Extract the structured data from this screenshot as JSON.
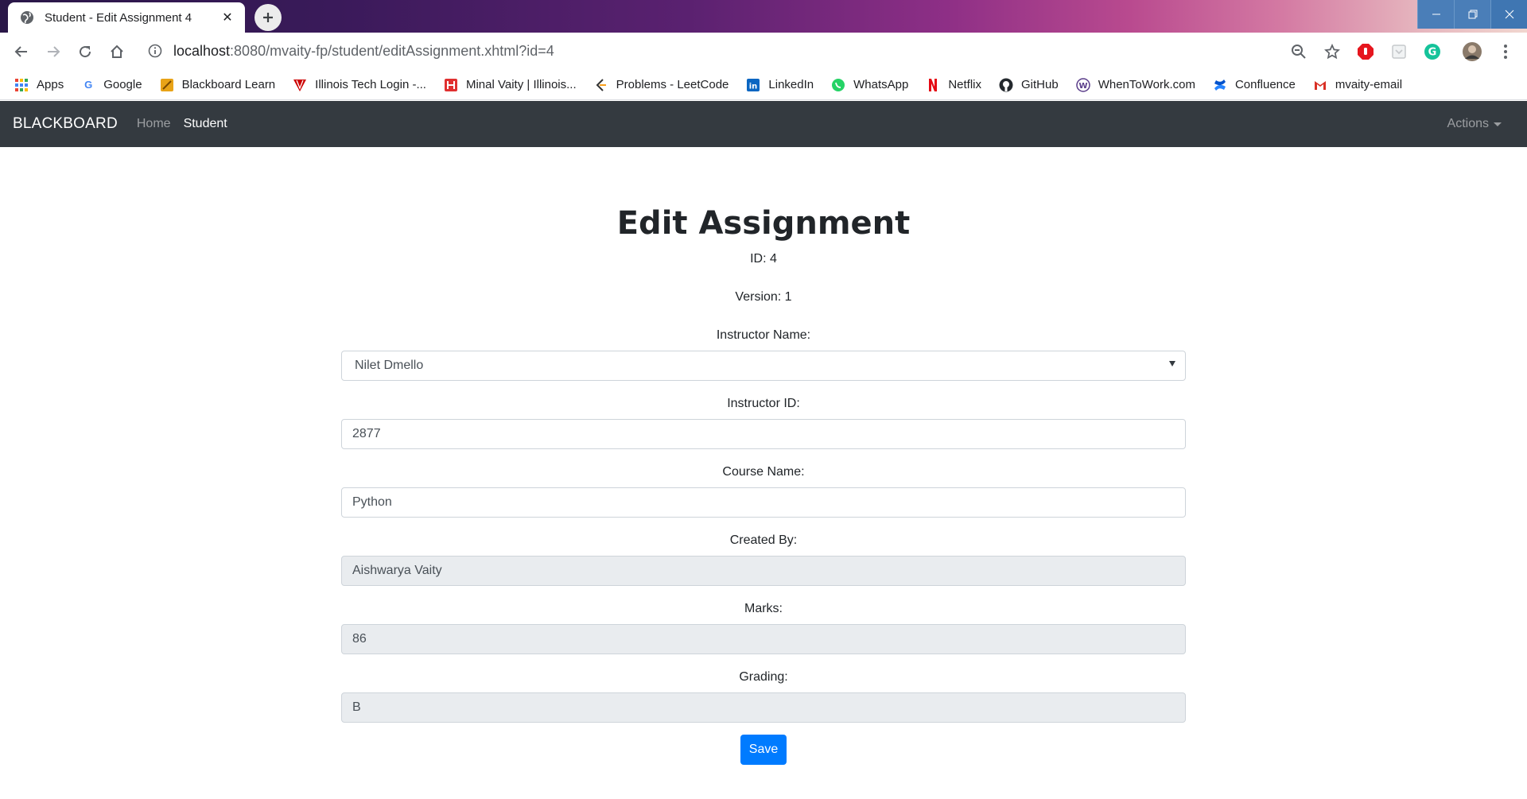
{
  "browser": {
    "tab_title": "Student - Edit Assignment 4",
    "url_host": "localhost",
    "url_rest": ":8080/mvaity-fp/student/editAssignment.xhtml?id=4",
    "bookmarks": [
      {
        "label": "Apps",
        "icon": "apps-grid-icon",
        "color": "#ea4335"
      },
      {
        "label": "Google",
        "icon": "google-icon",
        "color": "#4285f4"
      },
      {
        "label": "Blackboard Learn",
        "icon": "blackboard-icon",
        "color": "#e8a317"
      },
      {
        "label": "Illinois Tech Login -...",
        "icon": "illinois-tech-icon",
        "color": "#cc0000"
      },
      {
        "label": "Minal Vaity | Illinois...",
        "icon": "handshake-icon",
        "color": "#e03030"
      },
      {
        "label": "Problems - LeetCode",
        "icon": "leetcode-icon",
        "color": "#f89f1b"
      },
      {
        "label": "LinkedIn",
        "icon": "linkedin-icon",
        "color": "#0a66c2"
      },
      {
        "label": "WhatsApp",
        "icon": "whatsapp-icon",
        "color": "#25d366"
      },
      {
        "label": "Netflix",
        "icon": "netflix-icon",
        "color": "#e50914"
      },
      {
        "label": "GitHub",
        "icon": "github-icon",
        "color": "#24292e"
      },
      {
        "label": "WhenToWork.com",
        "icon": "whentowork-icon",
        "color": "#5a3d8a"
      },
      {
        "label": "Confluence",
        "icon": "confluence-icon",
        "color": "#2684ff"
      },
      {
        "label": "mvaity-email",
        "icon": "gmail-icon",
        "color": "#d93025"
      }
    ]
  },
  "site": {
    "brand": "BLACKBOARD",
    "nav": {
      "home": "Home",
      "student": "Student"
    },
    "actions": "Actions"
  },
  "form": {
    "title": "Edit Assignment",
    "id_text": "ID: 4",
    "version_text": "Version: 1",
    "instructor_name_label": "Instructor Name:",
    "instructor_name_value": "Nilet Dmello",
    "instructor_id_label": "Instructor ID:",
    "instructor_id_value": "2877",
    "course_name_label": "Course Name:",
    "course_name_value": "Python",
    "created_by_label": "Created By:",
    "created_by_value": "Aishwarya Vaity",
    "marks_label": "Marks:",
    "marks_value": "86",
    "grading_label": "Grading:",
    "grading_value": "B",
    "save_label": "Save"
  },
  "colors": {
    "navbar": "#343a40",
    "primary_button": "#007bff",
    "readonly_field": "#e9ecef"
  }
}
